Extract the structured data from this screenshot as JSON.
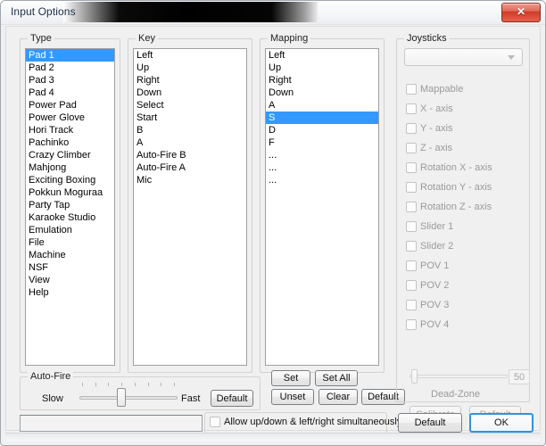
{
  "window": {
    "title": "Input Options",
    "close_label": "✕"
  },
  "groups": {
    "type_label": "Type",
    "key_label": "Key",
    "mapping_label": "Mapping",
    "joysticks_label": "Joysticks",
    "autofire_label": "Auto-Fire"
  },
  "type_list": {
    "items": [
      "Pad 1",
      "Pad 2",
      "Pad 3",
      "Pad 4",
      "Power Pad",
      "Power Glove",
      "Hori Track",
      "Pachinko",
      "Crazy Climber",
      "Mahjong",
      "Exciting Boxing",
      "Pokkun Moguraa",
      "Party Tap",
      "Karaoke Studio",
      "Emulation",
      "File",
      "Machine",
      "NSF",
      "View",
      "Help"
    ],
    "selected_index": 0
  },
  "key_list": {
    "items": [
      "Left",
      "Up",
      "Right",
      "Down",
      "Select",
      "Start",
      "B",
      "A",
      "Auto-Fire B",
      "Auto-Fire A",
      "Mic"
    ],
    "selected_index": -1
  },
  "mapping_list": {
    "items": [
      "Left",
      "Up",
      "Right",
      "Down",
      "A",
      "S",
      "D",
      "F",
      "...",
      "...",
      "..."
    ],
    "selected_index": 5
  },
  "joysticks": {
    "combo_value": "",
    "checkboxes": [
      "Mappable",
      "X - axis",
      "Y - axis",
      "Z - axis",
      "Rotation X - axis",
      "Rotation Y - axis",
      "Rotation Z - axis",
      "Slider 1",
      "Slider 2",
      "POV 1",
      "POV 2",
      "POV 3",
      "POV 4"
    ],
    "deadzone_value": "50",
    "deadzone_label": "Dead-Zone",
    "calibrate_label": "Calibrate",
    "default_label": "Default"
  },
  "mapping_buttons": {
    "set": "Set",
    "set_all": "Set All",
    "unset": "Unset",
    "clear": "Clear",
    "default": "Default"
  },
  "autofire": {
    "slow_label": "Slow",
    "fast_label": "Fast",
    "default_label": "Default"
  },
  "bottom": {
    "status_value": "",
    "allow_label": "Allow up/down & left/right simultaneously",
    "default_label": "Default",
    "ok_label": "OK"
  },
  "colors": {
    "selection": "#3399ff",
    "close_red": "#cf3b28",
    "focus_blue": "#2f93e0"
  }
}
